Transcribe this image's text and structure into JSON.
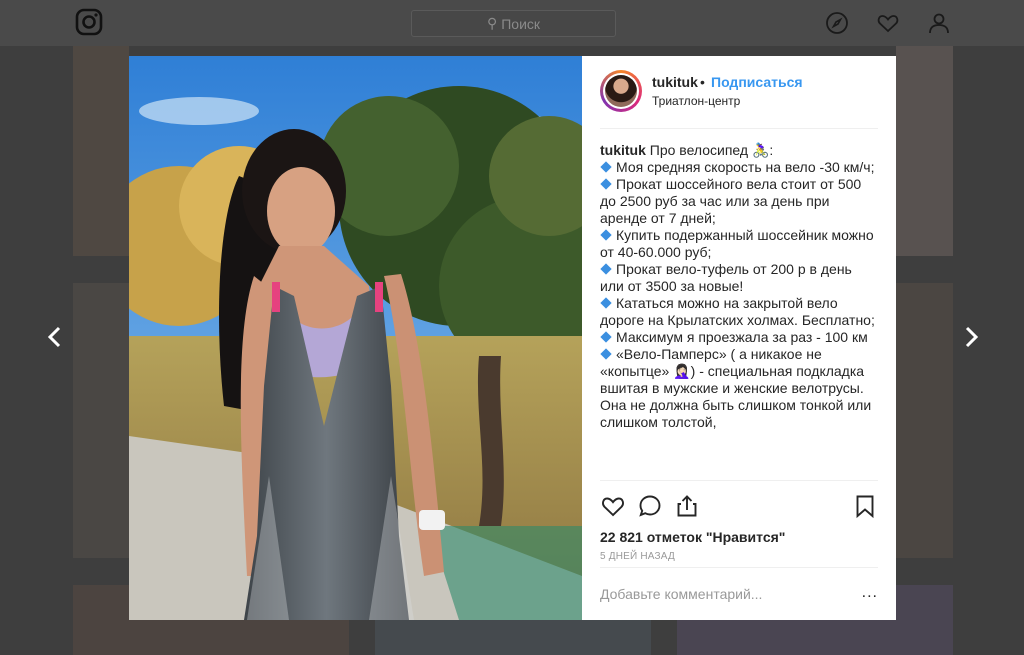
{
  "search": {
    "label": "Поиск"
  },
  "post": {
    "username": "tukituk",
    "dot": "•",
    "follow_label": "Подписаться",
    "location": "Триатлон-центр",
    "caption_user": "tukituk",
    "caption_intro": "Про велосипед 🚴‍♀️:",
    "caption_items": [
      "Моя средняя скорость на вело -30 км/ч;",
      "Прокат шоссейного вела стоит от 500 до 2500 руб за час или за день при аренде от 7 дней;",
      "Купить подержанный шоссейник можно от 40-60.000 руб;",
      "Прокат вело-туфель от 200 р в день или от 3500 за новые!",
      "Кататься можно на закрытой вело дороге на Крылатских холмах. Бесплатно;",
      "Максимум я проезжала за раз - 100 км",
      "«Вело-Памперс» ( а никакое не «копытце» 🤦🏻‍♀️) - специальная подкладка вшитая в мужские и женские велотрусы. Она не должна быть слишком тонкой или слишком толстой,"
    ],
    "likes": "22 821 отметок \"Нравится\"",
    "time_ago": "5 ДНЕЙ НАЗАД",
    "comment_placeholder": "Добавьте комментарий...",
    "more": "..."
  },
  "colors": {
    "follow": "#3897f0",
    "backdrop": "#3e3e3e",
    "bullet": "#3b8fe0"
  }
}
